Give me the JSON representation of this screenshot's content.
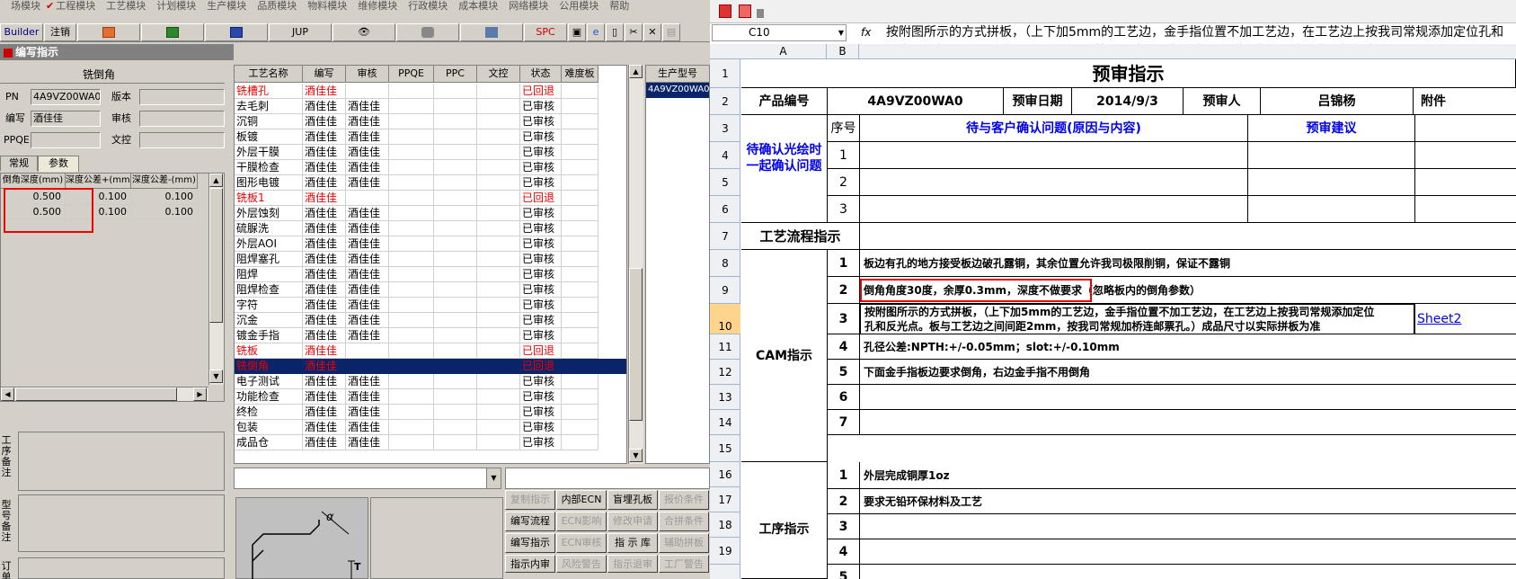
{
  "menubar": [
    "场模块",
    "工程模块",
    "工艺模块",
    "计划模块",
    "生产模块",
    "品质模块",
    "物料模块",
    "维修模块",
    "行政模块",
    "成本模块",
    "网络模块",
    "公用模块",
    "帮助"
  ],
  "toolbar": {
    "builder": "Builder",
    "logout": "注销",
    "jup": "JUP",
    "spc": "SPC"
  },
  "panel_title": "编写指示",
  "form": {
    "title": "铣倒角",
    "pn_label": "PN",
    "pn_value": "4A9VZ00WA0",
    "version_label": "版本",
    "writer_label": "编写",
    "writer_value": "酒佳佳",
    "review_label": "审核",
    "ppqe_label": "PPQE",
    "control_label": "文控"
  },
  "tabs": [
    "常规",
    "参数"
  ],
  "param_grid": {
    "headers": [
      "倒角深度(mm)",
      "深度公差+(mm)",
      "深度公差-(mm)"
    ],
    "rows": [
      [
        "0.500",
        "0.100",
        "0.100"
      ],
      [
        "0.500",
        "0.100",
        "0.100"
      ]
    ]
  },
  "memo_labels": [
    "工序备注",
    "型号备注",
    "订单"
  ],
  "proc_grid": {
    "headers": [
      "工艺名称",
      "编写",
      "审核",
      "PPQE",
      "PPC",
      "文控",
      "状态",
      "难度板"
    ],
    "rows": [
      {
        "name": "铣槽孔",
        "w": "酒佳佳",
        "r": "",
        "s": "已回退",
        "t": "red"
      },
      {
        "name": "去毛刺",
        "w": "酒佳佳",
        "r": "酒佳佳",
        "s": "已审核",
        "t": ""
      },
      {
        "name": "沉铜",
        "w": "酒佳佳",
        "r": "酒佳佳",
        "s": "已审核",
        "t": ""
      },
      {
        "name": "板镀",
        "w": "酒佳佳",
        "r": "酒佳佳",
        "s": "已审核",
        "t": ""
      },
      {
        "name": "外层干膜",
        "w": "酒佳佳",
        "r": "酒佳佳",
        "s": "已审核",
        "t": ""
      },
      {
        "name": "干膜检查",
        "w": "酒佳佳",
        "r": "酒佳佳",
        "s": "已审核",
        "t": ""
      },
      {
        "name": "图形电镀",
        "w": "酒佳佳",
        "r": "酒佳佳",
        "s": "已审核",
        "t": ""
      },
      {
        "name": "铣板1",
        "w": "酒佳佳",
        "r": "",
        "s": "已回退",
        "t": "red"
      },
      {
        "name": "外层蚀刻",
        "w": "酒佳佳",
        "r": "酒佳佳",
        "s": "已审核",
        "t": ""
      },
      {
        "name": "硫脲洗",
        "w": "酒佳佳",
        "r": "酒佳佳",
        "s": "已审核",
        "t": ""
      },
      {
        "name": "外层AOI",
        "w": "酒佳佳",
        "r": "酒佳佳",
        "s": "已审核",
        "t": ""
      },
      {
        "name": "阻焊塞孔",
        "w": "酒佳佳",
        "r": "酒佳佳",
        "s": "已审核",
        "t": ""
      },
      {
        "name": "阻焊",
        "w": "酒佳佳",
        "r": "酒佳佳",
        "s": "已审核",
        "t": ""
      },
      {
        "name": "阻焊检查",
        "w": "酒佳佳",
        "r": "酒佳佳",
        "s": "已审核",
        "t": ""
      },
      {
        "name": "字符",
        "w": "酒佳佳",
        "r": "酒佳佳",
        "s": "已审核",
        "t": ""
      },
      {
        "name": "沉金",
        "w": "酒佳佳",
        "r": "酒佳佳",
        "s": "已审核",
        "t": ""
      },
      {
        "name": "镀金手指",
        "w": "酒佳佳",
        "r": "酒佳佳",
        "s": "已审核",
        "t": ""
      },
      {
        "name": "铣板",
        "w": "酒佳佳",
        "r": "",
        "s": "已回退",
        "t": "red"
      },
      {
        "name": "铣倒角",
        "w": "酒佳佳",
        "r": "",
        "s": "已回退",
        "t": "sel"
      },
      {
        "name": "电子测试",
        "w": "酒佳佳",
        "r": "酒佳佳",
        "s": "已审核",
        "t": ""
      },
      {
        "name": "功能检查",
        "w": "酒佳佳",
        "r": "酒佳佳",
        "s": "已审核",
        "t": ""
      },
      {
        "name": "终检",
        "w": "酒佳佳",
        "r": "酒佳佳",
        "s": "已审核",
        "t": ""
      },
      {
        "name": "包装",
        "w": "酒佳佳",
        "r": "酒佳佳",
        "s": "已审核",
        "t": ""
      },
      {
        "name": "成品仓",
        "w": "酒佳佳",
        "r": "酒佳佳",
        "s": "已审核",
        "t": ""
      }
    ]
  },
  "prod_type": {
    "header": "生产型号",
    "value": "4A9VZ00WA0"
  },
  "drawing_label": "α",
  "action_buttons": [
    {
      "label": "复制指示",
      "dis": true
    },
    {
      "label": "内部ECN",
      "dis": false
    },
    {
      "label": "盲埋孔板",
      "dis": false
    },
    {
      "label": "报价条件",
      "dis": true
    },
    {
      "label": "编写流程",
      "dis": false
    },
    {
      "label": "ECN影响",
      "dis": true
    },
    {
      "label": "修改申请",
      "dis": true
    },
    {
      "label": "合拼条件",
      "dis": true
    },
    {
      "label": "编写指示",
      "dis": false
    },
    {
      "label": "ECN审核",
      "dis": true
    },
    {
      "label": "指 示 库",
      "dis": false
    },
    {
      "label": "辅助拼板",
      "dis": true
    },
    {
      "label": "指示内审",
      "dis": false
    },
    {
      "label": "风险警告",
      "dis": true
    },
    {
      "label": "指示退审",
      "dis": true
    },
    {
      "label": "工厂警告",
      "dis": true
    }
  ],
  "excel": {
    "namebox": "C10",
    "fx": "fx",
    "formula": "按附图所示的方式拼板，（上下加5mm的工艺边，金手指位置不加工艺边，在工艺边上按我司常规添加定位孔和反光点。板与工艺边之间间距2mm，按我司常规加桥连邮票孔。）成品尺寸以实际拼板为准",
    "columns": [
      "A",
      "B"
    ],
    "rows": [
      "1",
      "2",
      "3",
      "4",
      "5",
      "6",
      "7",
      "8",
      "9",
      "10",
      "11",
      "12",
      "13",
      "14",
      "15",
      "16",
      "17",
      "18",
      "19"
    ],
    "title": "预审指示",
    "product_no_label": "产品编号",
    "product_no": "4A9VZ00WA0",
    "date_label": "预审日期",
    "date": "2014/9/3",
    "reviewer_label": "预审人",
    "reviewer": "吕锦杨",
    "attach_label": "附件",
    "seq_label": "序号",
    "issue_label": "待与客户确认问题(原因与内容)",
    "suggest_label": "预审建议",
    "confirm_label_1": "待确认光绘时",
    "confirm_label_2": "一起确认问题",
    "flow_label": "工艺流程指示",
    "cam_label": "CAM指示",
    "proc_label": "工序指示",
    "cam_lines": [
      "板边有孔的地方接受板边破孔露铜，其余位置允许我司极限削铜，保证不露铜",
      "倒角角度30度，余厚0.3mm，深度不做要求（忽略板内的倒角参数）",
      "按附图所示的方式拼板，（上下加5mm的工艺边，金手指位置不加工艺边，在工艺边上按我司常规添加定位",
      "孔和反光点。板与工艺边之间间距2mm，按我司常规加桥连邮票孔。）成品尺寸以实际拼板为准",
      "孔径公差:NPTH:+/-0.05mm；slot:+/-0.10mm",
      "下面金手指板边要求倒角，右边金手指不用倒角"
    ],
    "proc_lines": [
      "外层完成铜厚1oz",
      "要求无铅环保材料及工艺"
    ],
    "sheet_link": "Sheet2"
  }
}
